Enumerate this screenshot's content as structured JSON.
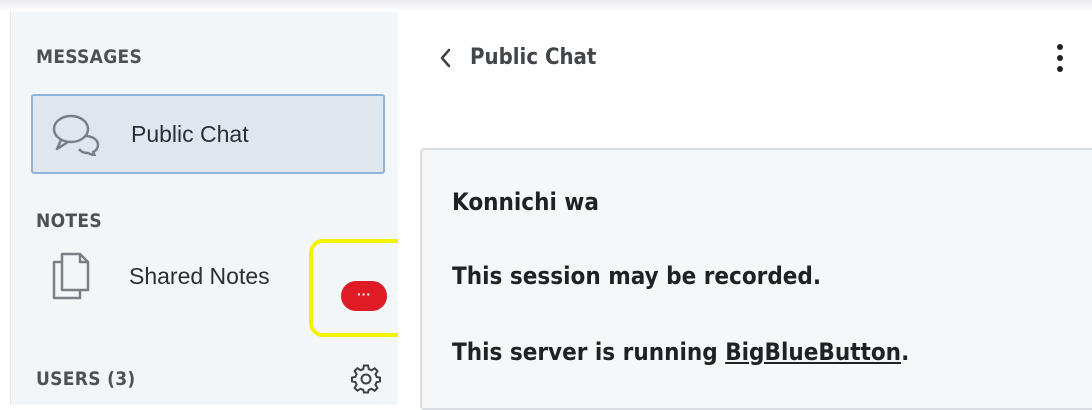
{
  "sidebar": {
    "messages_title": "MESSAGES",
    "public_chat_label": "Public Chat",
    "notes_title": "NOTES",
    "shared_notes_label": "Shared Notes",
    "shared_notes_badge": "···",
    "users_title": "USERS (3)"
  },
  "chat": {
    "title": "Public Chat",
    "messages": {
      "line1": "Konnichi wa",
      "line2": "This session may be recorded.",
      "line3_prefix": "This server is running ",
      "line3_link": "BigBlueButton",
      "line3_suffix": "."
    }
  },
  "colors": {
    "badge": "#df1c25",
    "highlight": "#f3f200",
    "selected_border": "#8fb4d9"
  },
  "icons": {
    "chat": "chat-bubbles-icon",
    "notes": "document-copy-icon",
    "gear": "gear-icon",
    "back": "chevron-left-icon",
    "menu": "kebab-menu-icon"
  }
}
